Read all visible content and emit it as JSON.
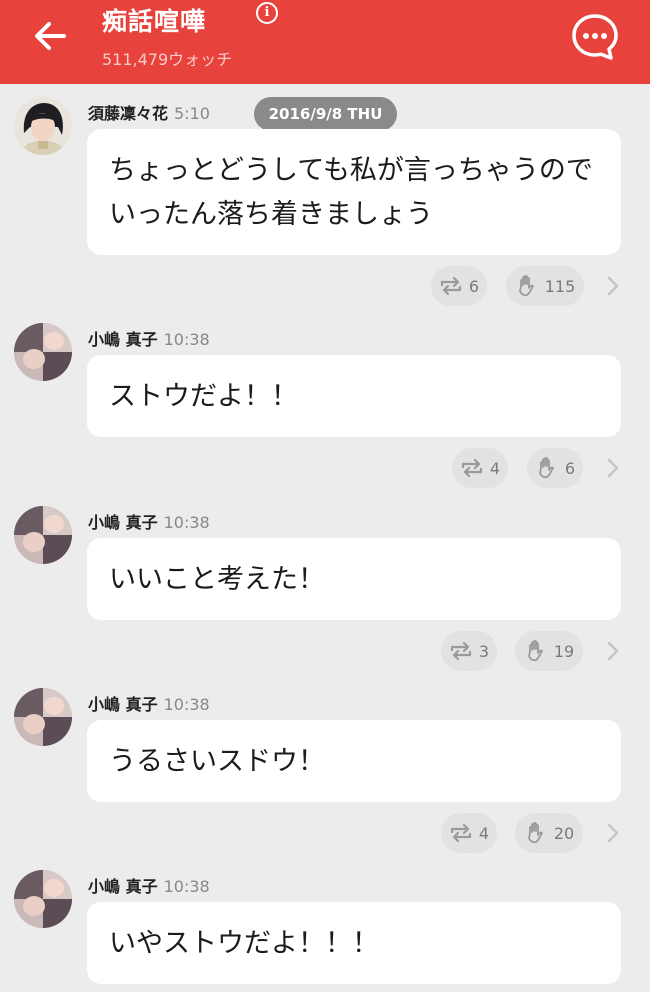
{
  "header": {
    "title": "痴話喧嘩",
    "subtitle": "511,479ウォッチ",
    "info_glyph": "i",
    "back_icon": "arrow-left-icon",
    "chat_icon": "speech-bubble-dots-icon",
    "background": "#e8423c"
  },
  "date_divider": "2016/9/8 THU",
  "messages": [
    {
      "name": "須藤凜々花",
      "time": "5:10",
      "text": "ちょっとどうしても私が言っちゃうのでいったん落ち着きましょう",
      "retweets": "6",
      "claps": "115"
    },
    {
      "name": "小嶋 真子",
      "time": "10:38",
      "text": "ストウだよ！！",
      "retweets": "4",
      "claps": "6"
    },
    {
      "name": "小嶋 真子",
      "time": "10:38",
      "text": "いいこと考えた！",
      "retweets": "3",
      "claps": "19"
    },
    {
      "name": "小嶋 真子",
      "time": "10:38",
      "text": "うるさいスドウ！",
      "retweets": "4",
      "claps": "20"
    },
    {
      "name": "小嶋 真子",
      "time": "10:38",
      "text": "いやストウだよ！！！"
    }
  ]
}
